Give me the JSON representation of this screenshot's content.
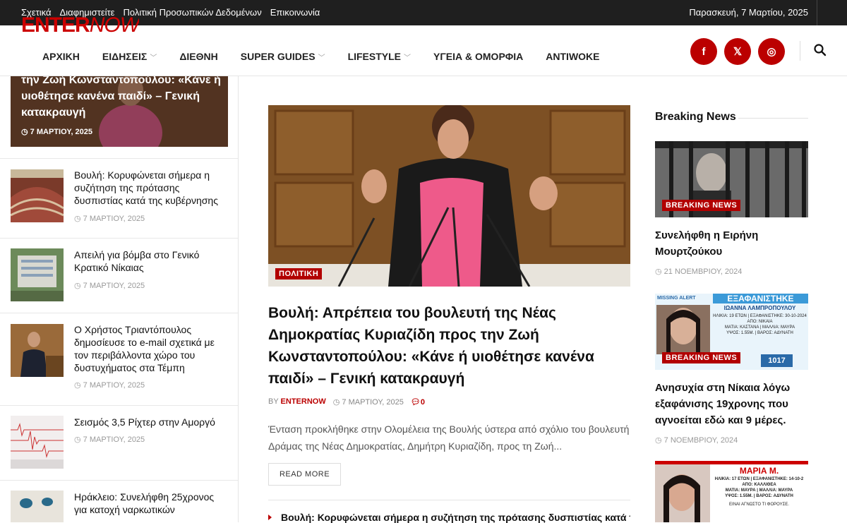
{
  "topbar": {
    "links": [
      "Σχετικά",
      "Διαφημιστείτε",
      "Πολιτική Προσωπικών Δεδομένων",
      "Επικοινωνία"
    ],
    "date": "Παρασκευή, 7 Μαρτίου, 2025"
  },
  "logo": {
    "part1": "ENTER",
    "part2": "NOW"
  },
  "nav": [
    {
      "label": "ΑΡΧΙΚΗ",
      "dropdown": false
    },
    {
      "label": "ΕΙΔΗΣΕΙΣ",
      "dropdown": true
    },
    {
      "label": "ΔΙΕΘΝΗ",
      "dropdown": false
    },
    {
      "label": "SUPER GUIDES",
      "dropdown": true
    },
    {
      "label": "LIFESTYLE",
      "dropdown": true
    },
    {
      "label": "ΥΓΕΙΑ & ΟΜΟΡΦΙΑ",
      "dropdown": false
    },
    {
      "label": "ANTIWOKE",
      "dropdown": false
    }
  ],
  "social": {
    "facebook": "f",
    "x": "𝕏",
    "instagram": "◎"
  },
  "colors": {
    "accent": "#b20000",
    "topbar": "#1f1f1f"
  },
  "left": {
    "hero": {
      "title": "την Ζωή Κωνσταντοπούλου: «Κάνε ή υιοθέτησε κανένα παιδί»  – Γενική κατακραυγή",
      "date": "7 ΜΑΡΤΙΟΥ, 2025"
    },
    "items": [
      {
        "title": "Βουλή: Κορυφώνεται σήμερα η συζήτηση της πρότασης δυσπιστίας κατά της κυβέρνησης",
        "date": "7 ΜΑΡΤΙΟΥ, 2025"
      },
      {
        "title": "Απειλή για βόμβα στο Γενικό Κρατικό Νίκαιας",
        "date": "7 ΜΑΡΤΙΟΥ, 2025"
      },
      {
        "title": "Ο Χρήστος Τριαντόπουλος δημοσίευσε το e-mail σχετικά με τον περιβάλλοντα χώρο του δυστυχήματος στα Τέμπη",
        "date": "7 ΜΑΡΤΙΟΥ, 2025"
      },
      {
        "title": "Σεισμός 3,5 Ρίχτερ στην Αμοργό",
        "date": "7 ΜΑΡΤΙΟΥ, 2025"
      },
      {
        "title": "Ηράκλειο: Συνελήφθη 25χρονος για κατοχή ναρκωτικών",
        "date": ""
      }
    ]
  },
  "main": {
    "category": "ΠΟΛΙΤΙΚΗ",
    "title": "Βουλή: Απρέπεια του βουλευτή της Νέας Δημοκρατίας Κυριαζίδη προς την Ζωή Κωνσταντοπούλου: «Κάνε ή υιοθέτησε κανένα παιδί»  – Γενική κατακραυγή",
    "by": "BY",
    "author": "ENTERNOW",
    "date": "7 ΜΑΡΤΙΟΥ, 2025",
    "comments": "0",
    "excerpt": "Ένταση προκλήθηκε στην Ολομέλεια της Βουλής ύστερα από σχόλιο του βουλευτή Δράμας της Νέας Δημοκρατίας, Δημήτρη Κυριαζίδη, προς τη Ζωή...",
    "read_more": "READ MORE",
    "next_title": "Βουλή: Κορυφώνεται σήμερα η συζήτηση της πρότασης δυσπιστίας κατά της"
  },
  "breaking": {
    "heading": "Breaking News",
    "tag": "BREAKING NEWS",
    "cards": [
      {
        "title": "Συνελήφθη η Ειρήνη Μουρτζούκου",
        "date": "21 ΝΟΕΜΒΡΙΟΥ, 2024"
      },
      {
        "title": "Ανησυχία στη Νίκαια λόγω εξαφάνισης 19χρονης που αγνοείται εδώ και 9 μέρες.",
        "date": "7 ΝΟΕΜΒΡΙΟΥ, 2024",
        "poster": {
          "header": "ΕΞΑΦΑΝΙΣΤΗΚΕ",
          "name": "ΙΩΑΝΝΑ ΛΑΜΠΡΟΠΟΥΛΟΥ",
          "line1": "ΗΛΙΚΙΑ: 19 ΕΤΩΝ | ΕΞΑΦΑΝΙΣΤΗΚΕ: 30-10-2024",
          "line2": "ΑΠΟ: ΝΙΚΑΙΑ",
          "line3": "ΜΑΤΙΑ: ΚΑΣΤΑΝΑ | ΜΑΛΛΙΑ: ΜΑΥΡΑ",
          "line4": "ΥΨΟΣ: 1.55Μ. | ΒΑΡΟΣ: ΑΔΥΝΑΤΗ",
          "badge": "MISSING ALERT",
          "phone": "1017"
        }
      },
      {
        "title": "",
        "date": "",
        "poster": {
          "name": "ΜΑΡΙΑ Μ.",
          "line1": "ΗΛΙΚΙΑ: 17 ΕΤΩΝ | ΕΞΑΦΑΝΙΣΤΗΚΕ: 14-10-2",
          "line2": "ΑΠΟ: ΚΑΛΛΙΘΕΑ",
          "line3": "ΜΑΤΙΑ: ΜΑΥΡΑ | ΜΑΛΛΙΑ: ΜΑΥΡΑ",
          "line4": "ΥΨΟΣ: 1.55Μ. | ΒΑΡΟΣ: ΑΔΥΝΑΤΗ",
          "line5": "ΕΙΝΑΙ ΑΓΝΩΣΤΟ ΤΙ ΦΟΡΟΥΣΕ."
        }
      }
    ]
  }
}
